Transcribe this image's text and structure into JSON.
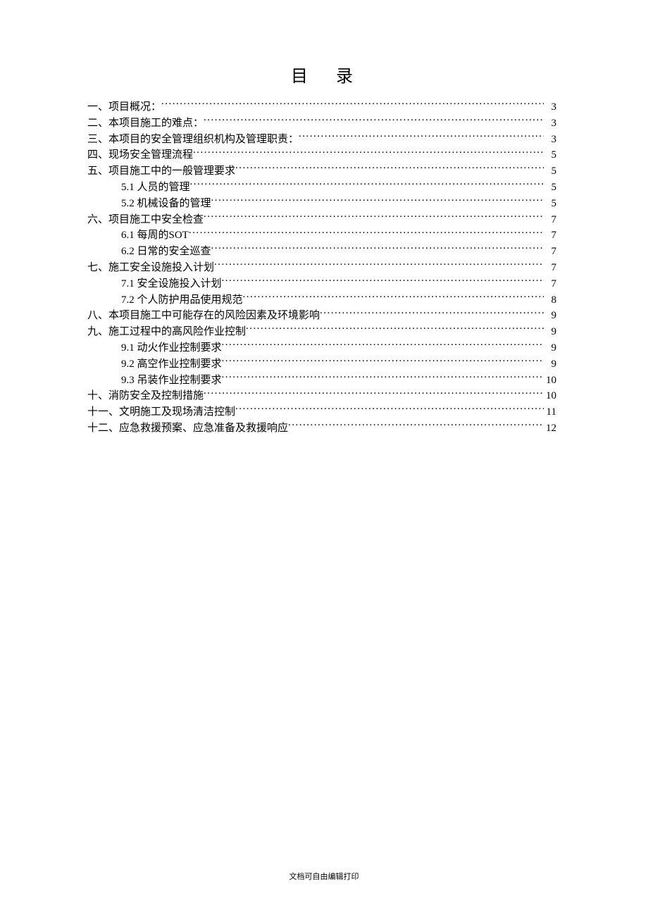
{
  "title": "目录",
  "toc": [
    {
      "level": 1,
      "text": "一、项目概况：",
      "page": "3"
    },
    {
      "level": 1,
      "text": "二、本项目施工的难点：",
      "page": "3"
    },
    {
      "level": 1,
      "text": "三、本项目的安全管理组织机构及管理职责：",
      "page": "3"
    },
    {
      "level": 1,
      "text": "四、现场安全管理流程",
      "page": "5"
    },
    {
      "level": 1,
      "text": "五、项目施工中的一般管理要求",
      "page": "5"
    },
    {
      "level": 2,
      "text": "5.1 人员的管理",
      "page": "5"
    },
    {
      "level": 2,
      "text": "5.2 机械设备的管理",
      "page": "5"
    },
    {
      "level": 1,
      "text": "六、项目施工中安全检查",
      "page": "7"
    },
    {
      "level": 2,
      "text": "6.1 每周的SOT",
      "page": "7"
    },
    {
      "level": 2,
      "text": "6.2 日常的安全巡查",
      "page": "7"
    },
    {
      "level": 1,
      "text": "七、施工安全设施投入计划",
      "page": "7"
    },
    {
      "level": 2,
      "text": "7.1 安全设施投入计划",
      "page": "7"
    },
    {
      "level": 2,
      "text": "7.2 个人防护用品使用规范",
      "page": "8"
    },
    {
      "level": 1,
      "text": "八、本项目施工中可能存在的风险因素及环境影响",
      "page": "9"
    },
    {
      "level": 1,
      "text": "九、施工过程中的高风险作业控制",
      "page": "9"
    },
    {
      "level": 2,
      "text": "9.1 动火作业控制要求",
      "page": "9"
    },
    {
      "level": 2,
      "text": "9.2 高空作业控制要求",
      "page": "9"
    },
    {
      "level": 2,
      "text": "9.3 吊装作业控制要求",
      "page": "10"
    },
    {
      "level": 1,
      "text": "十、消防安全及控制措施",
      "page": "10"
    },
    {
      "level": 1,
      "text": "十一、文明施工及现场清洁控制",
      "page": "11"
    },
    {
      "level": 1,
      "text": "十二、应急救援预案、应急准备及救援响应",
      "page": "12"
    }
  ],
  "footer": "文档可自由编辑打印"
}
